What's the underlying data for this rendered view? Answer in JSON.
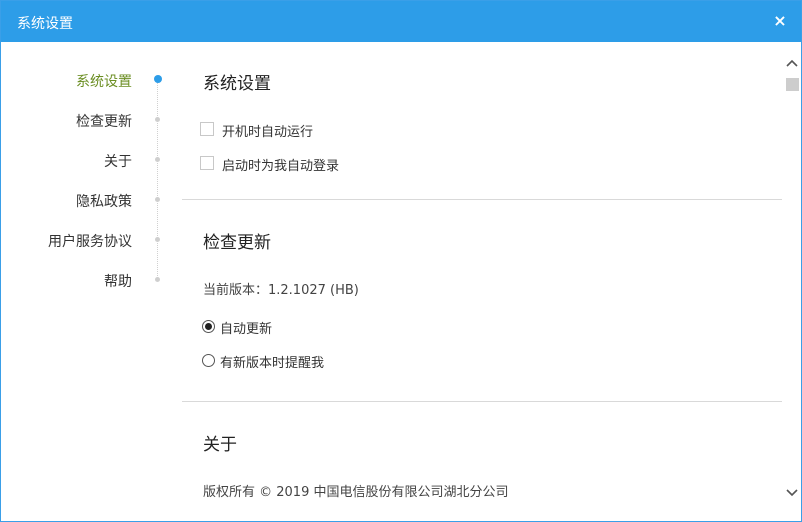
{
  "window": {
    "title": "系统设置",
    "close_glyph": "×"
  },
  "nav": {
    "items": [
      {
        "label": "系统设置",
        "active": true
      },
      {
        "label": "检查更新",
        "active": false
      },
      {
        "label": "关于",
        "active": false
      },
      {
        "label": "隐私政策",
        "active": false
      },
      {
        "label": "用户服务协议",
        "active": false
      },
      {
        "label": "帮助",
        "active": false
      }
    ]
  },
  "system_settings": {
    "title": "系统设置",
    "options": [
      {
        "label": "开机时自动运行",
        "checked": false
      },
      {
        "label": "启动时为我自动登录",
        "checked": false
      }
    ]
  },
  "check_update": {
    "title": "检查更新",
    "version_text": "当前版本：1.2.1027 (HB)",
    "options": [
      {
        "label": "自动更新",
        "selected": true
      },
      {
        "label": "有新版本时提醒我",
        "selected": false
      }
    ]
  },
  "about": {
    "title": "关于",
    "copyright": "版权所有 © 2019 中国电信股份有限公司湖北分公司"
  },
  "scrollbar": {
    "up_glyph": "⌃",
    "down_glyph": "⌄"
  },
  "colors": {
    "accent": "#2d9de8",
    "active_nav": "#6b8e23"
  },
  "icons": {
    "close": "close-icon",
    "scroll_up": "chevron-up-icon",
    "scroll_down": "chevron-down-icon"
  }
}
